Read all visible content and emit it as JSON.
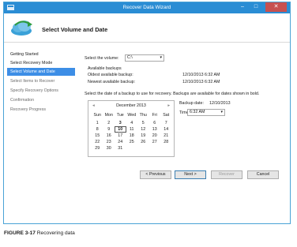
{
  "window": {
    "title": "Recover Data Wizard",
    "minimize": "–",
    "maximize": "□",
    "close": "✕"
  },
  "header": {
    "title": "Select Volume and Date",
    "icon": "cloud-arrow-icon"
  },
  "steps": [
    {
      "label": "Getting Started",
      "state": "done"
    },
    {
      "label": "Select Recovery Mode",
      "state": "done"
    },
    {
      "label": "Select Volume and Date",
      "state": "active"
    },
    {
      "label": "Select Items to Recover",
      "state": "disabled"
    },
    {
      "label": "Specify Recovery Options",
      "state": "disabled"
    },
    {
      "label": "Confirmation",
      "state": "disabled"
    },
    {
      "label": "Recovery Progress",
      "state": "disabled"
    }
  ],
  "volume": {
    "label": "Select the volume:",
    "value": "C:\\"
  },
  "backups": {
    "heading": "Available backups",
    "oldest_label": "Oldest available backup:",
    "oldest_value": "12/10/2013 6:32 AM",
    "newest_label": "Newest available backup:",
    "newest_value": "12/10/2013 6:32 AM"
  },
  "instruction": "Select the date of a backup to use for recovery. Backups are available for dates shown in bold.",
  "calendar": {
    "month": "December 2013",
    "prev": "◂",
    "next": "▸",
    "weekdays": [
      "Sun",
      "Mon",
      "Tue",
      "Wed",
      "Thu",
      "Fri",
      "Sat"
    ],
    "weeks": [
      [
        "1",
        "2",
        "3",
        "4",
        "5",
        "6",
        "7"
      ],
      [
        "8",
        "9",
        "10",
        "11",
        "12",
        "13",
        "14"
      ],
      [
        "15",
        "16",
        "17",
        "18",
        "19",
        "20",
        "21"
      ],
      [
        "22",
        "23",
        "24",
        "25",
        "26",
        "27",
        "28"
      ],
      [
        "29",
        "30",
        "31",
        "",
        "",
        "",
        ""
      ]
    ],
    "bold_days": [
      "3",
      "10"
    ],
    "selected_day": "10"
  },
  "backup_date": {
    "label": "Backup date:",
    "value": "12/10/2013"
  },
  "time": {
    "label": "Time:",
    "value": "6:32 AM"
  },
  "buttons": {
    "previous": "< Previous",
    "next": "Next >",
    "recover": "Recover",
    "cancel": "Cancel"
  },
  "caption": {
    "figure": "FIGURE 3-17",
    "text": "Recovering data"
  },
  "colors": {
    "titlebar": "#2a8dd4",
    "active_step": "#3d8ee6",
    "close": "#c75050"
  }
}
